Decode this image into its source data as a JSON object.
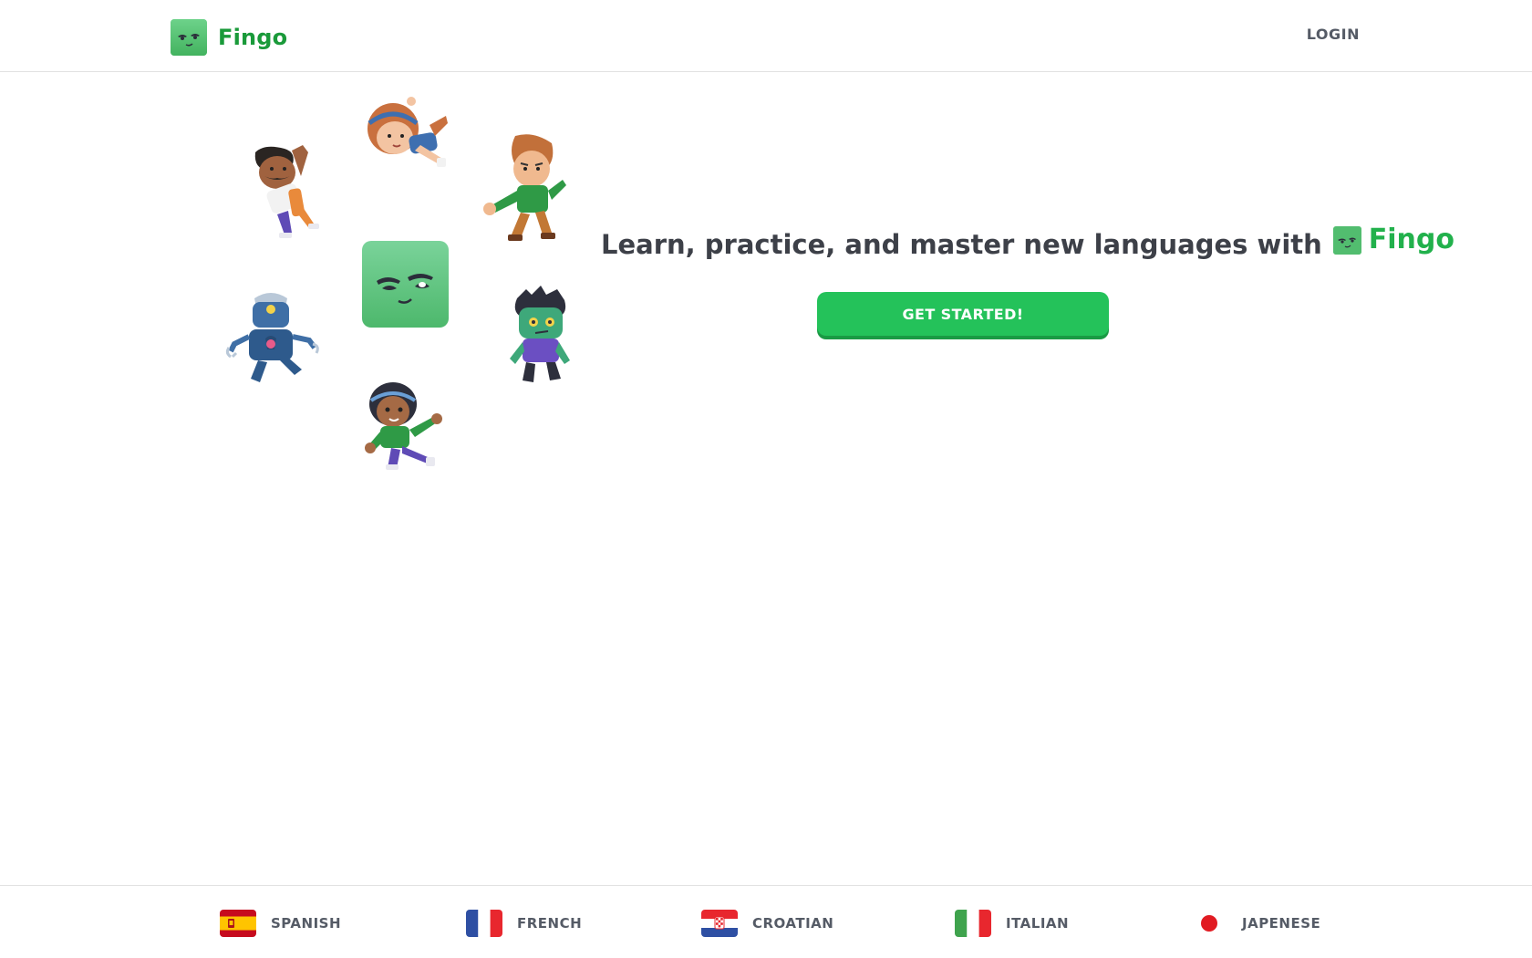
{
  "header": {
    "brand_name": "Fingo",
    "login_label": "LOGIN"
  },
  "hero": {
    "tagline": "Learn, practice, and master new languages with",
    "tagline_brand": "Fingo",
    "cta_label": "GET STARTED!"
  },
  "languages": [
    {
      "label": "SPANISH",
      "flag": "spain-flag"
    },
    {
      "label": "FRENCH",
      "flag": "france-flag"
    },
    {
      "label": "CROATIAN",
      "flag": "croatia-flag"
    },
    {
      "label": "ITALIAN",
      "flag": "italy-flag"
    },
    {
      "label": "JAPENESE",
      "flag": "japan-flag"
    }
  ],
  "colors": {
    "brand_green": "#22b14c",
    "button_green": "#24c25a",
    "text_dark": "#3d4048",
    "text_gray": "#555b66"
  }
}
